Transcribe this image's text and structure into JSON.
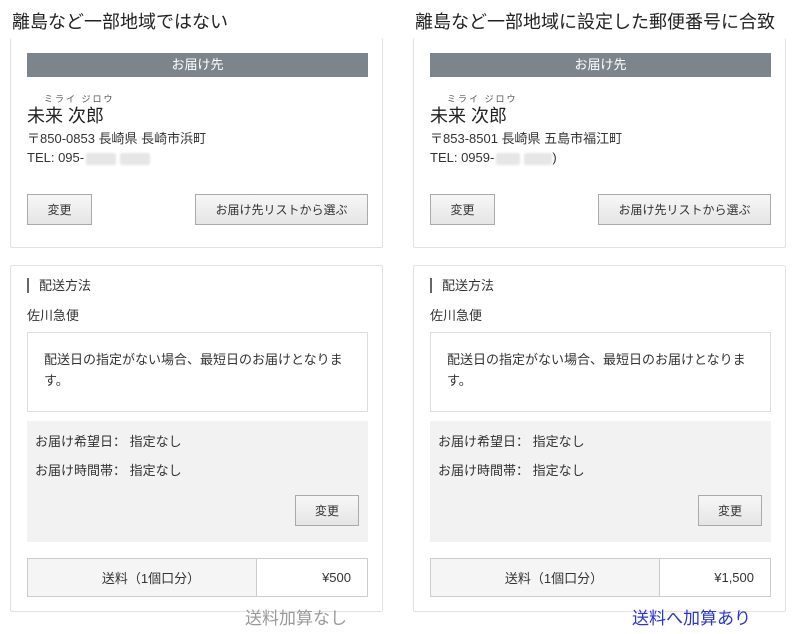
{
  "left": {
    "caption": "離島など一部地域ではない",
    "address": {
      "header": "お届け先",
      "furigana": "ミライ ジロウ",
      "name": "未来 次郎",
      "zip_line": "〒850-0853 長崎県 長崎市浜町",
      "tel_prefix": "TEL: 095-",
      "tel_suffix": "",
      "change_label": "変更",
      "list_label": "お届け先リストから選ぶ"
    },
    "shipping": {
      "title": "配送方法",
      "carrier": "佐川急便",
      "notice": "配送日の指定がない場合、最短日のお届けとなります。",
      "date_row": "お届け希望日： 指定なし",
      "time_row": "お届け時間帯： 指定なし",
      "change_label": "変更",
      "fee_label": "送料（1個口分）",
      "fee_value": "¥500"
    },
    "note": "送料加算なし",
    "note_color": "#9a9a9a"
  },
  "right": {
    "caption": "離島など一部地域に設定した郵便番号に合致",
    "address": {
      "header": "お届け先",
      "furigana": "ミライ ジロウ",
      "name": "未来 次郎",
      "zip_line": "〒853-8501 長崎県 五島市福江町",
      "tel_prefix": "TEL: 0959-",
      "tel_suffix": ")",
      "change_label": "変更",
      "list_label": "お届け先リストから選ぶ"
    },
    "shipping": {
      "title": "配送方法",
      "carrier": "佐川急便",
      "notice": "配送日の指定がない場合、最短日のお届けとなります。",
      "date_row": "お届け希望日： 指定なし",
      "time_row": "お届け時間帯： 指定なし",
      "change_label": "変更",
      "fee_label": "送料（1個口分）",
      "fee_value": "¥1,500"
    },
    "note": "送料へ加算あり",
    "note_color": "#2a35d6"
  },
  "colors": {
    "header_bg": "#7d858c",
    "pref_bg": "#f2f2f2"
  }
}
